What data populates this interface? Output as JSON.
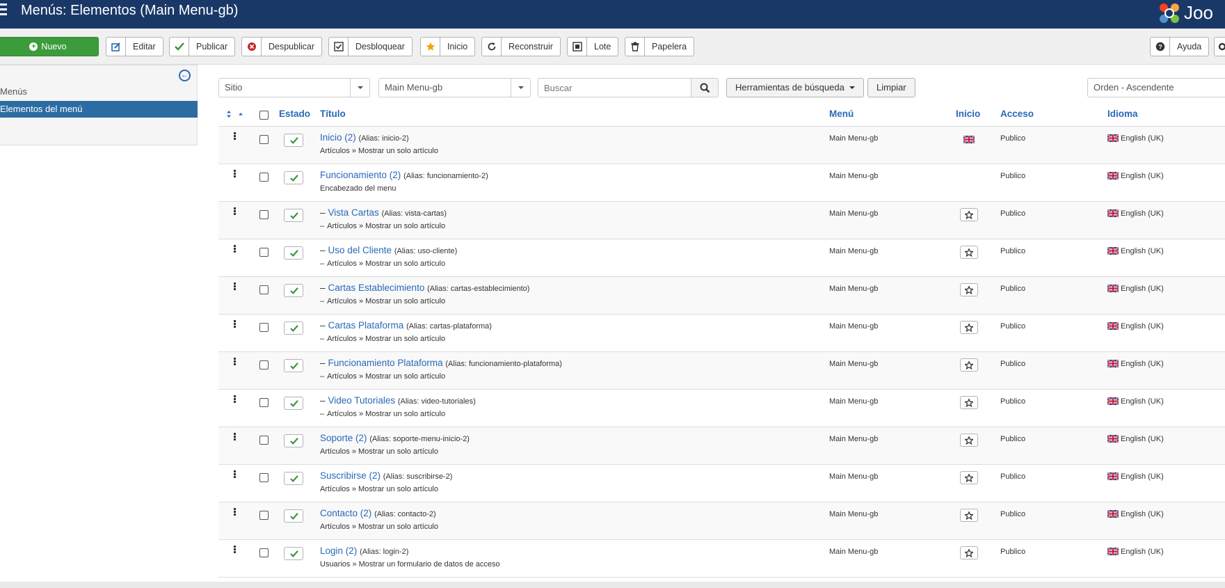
{
  "header": {
    "title": "Menús: Elementos (Main Menu-gb)",
    "logo_text": "Joo"
  },
  "toolbar": {
    "new": "Nuevo",
    "edit": "Editar",
    "publish": "Publicar",
    "unpublish": "Despublicar",
    "unlock": "Desbloquear",
    "home": "Inicio",
    "rebuild": "Reconstruir",
    "batch": "Lote",
    "trash": "Papelera",
    "help": "Ayuda"
  },
  "sidebar": {
    "items": [
      {
        "label": "Menús"
      },
      {
        "label": "Elementos del menú"
      }
    ]
  },
  "filters": {
    "site": "Sitio",
    "menu": "Main Menu-gb",
    "search_placeholder": "Buscar",
    "search_tools": "Herramientas de búsqueda",
    "clear": "Limpiar",
    "ordering": "Orden - Ascendente"
  },
  "table": {
    "headers": {
      "status": "Estado",
      "title": "Título",
      "menu": "Menú",
      "home": "Inicio",
      "access": "Acceso",
      "language": "Idioma"
    },
    "rows": [
      {
        "title": "Inicio (2)",
        "alias": "(Alias: inicio-2)",
        "type": "Artículos » Mostrar un solo artículo",
        "menu": "Main Menu-gb",
        "access": "Publico",
        "language": "English (UK)",
        "child": false,
        "home": "flag"
      },
      {
        "title": "Funcionamiento (2)",
        "alias": "(Alias: funcionamiento-2)",
        "type": "Encabezado del menu",
        "menu": "Main Menu-gb",
        "access": "Publico",
        "language": "English (UK)",
        "child": false,
        "home": "none"
      },
      {
        "title": "Vista Cartas",
        "alias": "(Alias: vista-cartas)",
        "type": "Artículos » Mostrar un solo artículo",
        "menu": "Main Menu-gb",
        "access": "Publico",
        "language": "English (UK)",
        "child": true,
        "home": "star"
      },
      {
        "title": "Uso del Cliente",
        "alias": "(Alias: uso-cliente)",
        "type": "Artículos » Mostrar un solo artículo",
        "menu": "Main Menu-gb",
        "access": "Publico",
        "language": "English (UK)",
        "child": true,
        "home": "star"
      },
      {
        "title": "Cartas Establecimiento",
        "alias": "(Alias: cartas-establecimiento)",
        "type": "Artículos » Mostrar un solo artículo",
        "menu": "Main Menu-gb",
        "access": "Publico",
        "language": "English (UK)",
        "child": true,
        "home": "star"
      },
      {
        "title": "Cartas Plataforma",
        "alias": "(Alias: cartas-plataforma)",
        "type": "Artículos » Mostrar un solo artículo",
        "menu": "Main Menu-gb",
        "access": "Publico",
        "language": "English (UK)",
        "child": true,
        "home": "star"
      },
      {
        "title": "Funcionamiento Plataforma",
        "alias": "(Alias: funcionamiento-plataforma)",
        "type": "Artículos » Mostrar un solo artículo",
        "menu": "Main Menu-gb",
        "access": "Publico",
        "language": "English (UK)",
        "child": true,
        "home": "star"
      },
      {
        "title": "Video Tutoriales",
        "alias": "(Alias: video-tutoriales)",
        "type": "Artículos » Mostrar un solo artículo",
        "menu": "Main Menu-gb",
        "access": "Publico",
        "language": "English (UK)",
        "child": true,
        "home": "star"
      },
      {
        "title": "Soporte (2)",
        "alias": "(Alias: soporte-menu-inicio-2)",
        "type": "Artículos » Mostrar un solo artículo",
        "menu": "Main Menu-gb",
        "access": "Publico",
        "language": "English (UK)",
        "child": false,
        "home": "star"
      },
      {
        "title": "Suscribirse (2)",
        "alias": "(Alias: suscribirse-2)",
        "type": "Artículos » Mostrar un solo artículo",
        "menu": "Main Menu-gb",
        "access": "Publico",
        "language": "English (UK)",
        "child": false,
        "home": "star"
      },
      {
        "title": "Contacto (2)",
        "alias": "(Alias: contacto-2)",
        "type": "Artículos » Mostrar un solo artículo",
        "menu": "Main Menu-gb",
        "access": "Publico",
        "language": "English (UK)",
        "child": false,
        "home": "star"
      },
      {
        "title": "Login (2)",
        "alias": "(Alias: login-2)",
        "type": "Usuarios » Mostrar un formulario de datos de acceso",
        "menu": "Main Menu-gb",
        "access": "Publico",
        "language": "English (UK)",
        "child": false,
        "home": "star"
      }
    ]
  },
  "colors": {
    "header_bg": "#1a3867",
    "link": "#2a69b8",
    "new_button": "#3c9c3c",
    "active_sidebar": "#2d6ca2",
    "published_check": "#3c8f3c"
  }
}
